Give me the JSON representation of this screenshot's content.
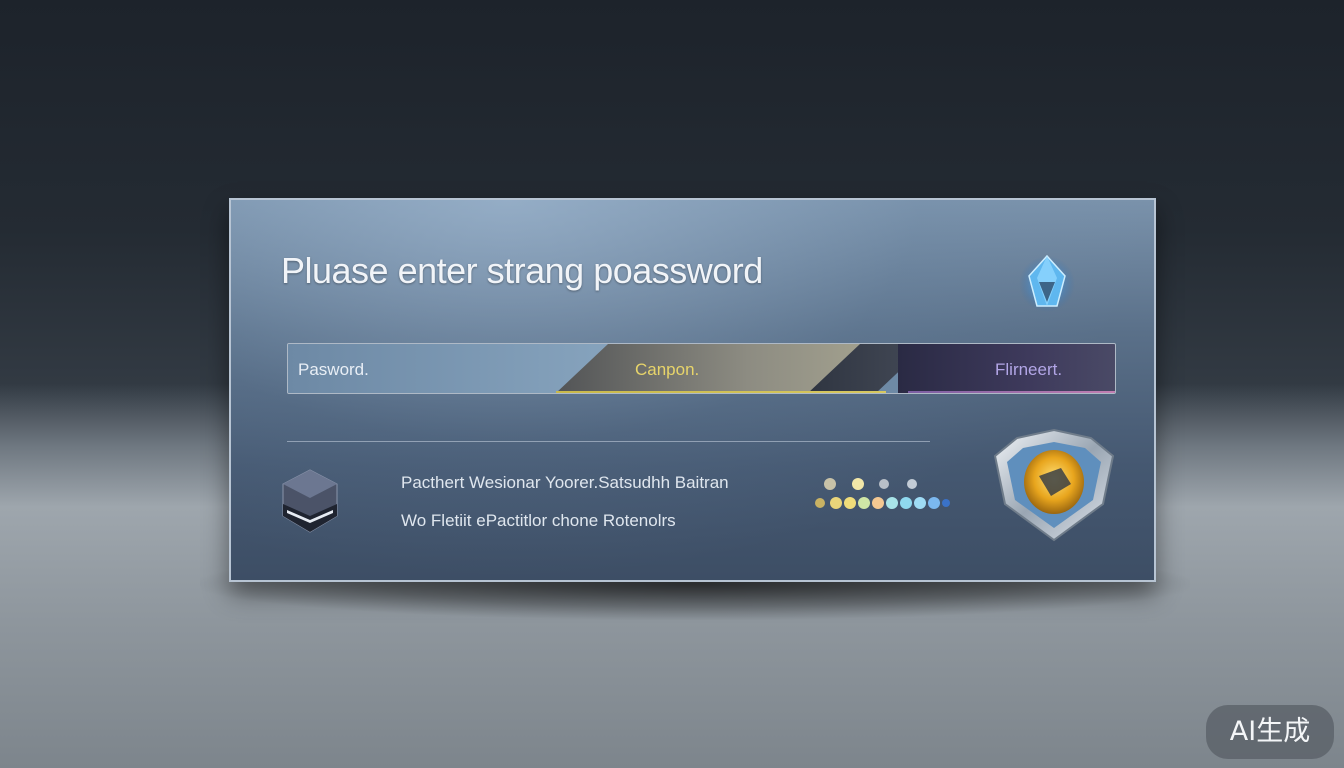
{
  "dialog": {
    "title": "Pluase enter strang poassword"
  },
  "password_field": {
    "label_left": "Pasword.",
    "label_middle": "Canpon.",
    "label_right": "Flirneert."
  },
  "info": {
    "line1": "Pacthert  Wesionar  Yoorer.Satsudhh  Baitran",
    "line2": "Wo Fletiit ePactitlor chone  Rotenolrs"
  },
  "icons": {
    "top_right": "crystal-gem-icon",
    "left": "hexagon-block-icon",
    "right": "shield-badge-icon"
  },
  "colors": {
    "strength_weak": "#86a3bd",
    "strength_mid": "#d7c860",
    "strength_strong": "#c47fb2"
  },
  "watermark": {
    "label": "AI生成"
  }
}
